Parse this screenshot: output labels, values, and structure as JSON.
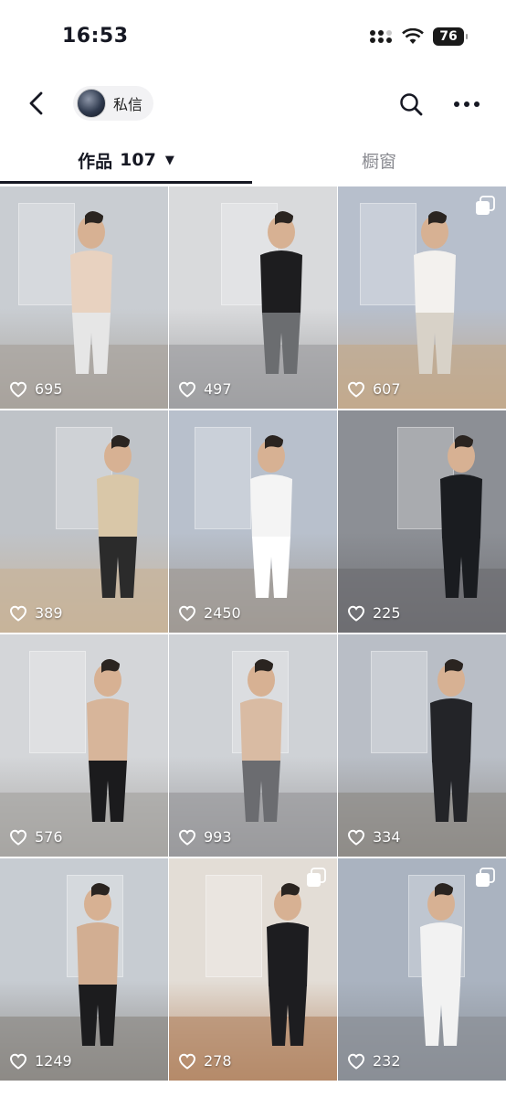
{
  "status_bar": {
    "time": "16:53",
    "battery": "76"
  },
  "nav": {
    "pill_label": "私信"
  },
  "tabs": {
    "works_label": "作品",
    "works_count": "107",
    "caret": "▼",
    "shop_label": "橱窗"
  },
  "posts": [
    {
      "likes": "695",
      "multi": false,
      "bg": "#c9cdd2",
      "floor": "#a8a39c",
      "shirt": "#e8d2c0",
      "pants": "#e6e6e6"
    },
    {
      "likes": "497",
      "multi": false,
      "bg": "#d9dadc",
      "floor": "#9fa0a2",
      "shirt": "#1d1d1f",
      "pants": "#6b6d70"
    },
    {
      "likes": "607",
      "multi": true,
      "bg": "#b7bfcc",
      "floor": "#c2a98d",
      "shirt": "#f3f1ee",
      "pants": "#d8d2c8"
    },
    {
      "likes": "389",
      "multi": false,
      "bg": "#bfc3c8",
      "floor": "#c7b39a",
      "shirt": "#d9c7a8",
      "pants": "#2b2b2b"
    },
    {
      "likes": "2450",
      "multi": false,
      "bg": "#b8c0cc",
      "floor": "#a09a94",
      "shirt": "#f4f4f4",
      "pants": "#ffffff"
    },
    {
      "likes": "225",
      "multi": false,
      "bg": "#8c8f95",
      "floor": "#6e6e72",
      "shirt": "#1a1c20",
      "pants": "#1a1c20"
    },
    {
      "likes": "576",
      "multi": false,
      "bg": "#d4d6d9",
      "floor": "#a7a5a2",
      "shirt": "#d7b59a",
      "pants": "#1b1b1d"
    },
    {
      "likes": "993",
      "multi": false,
      "bg": "#cfd2d6",
      "floor": "#9a9a9c",
      "shirt": "#d9bba3",
      "pants": "#6b6c70"
    },
    {
      "likes": "334",
      "multi": false,
      "bg": "#b9bec6",
      "floor": "#8f8c88",
      "shirt": "#232428",
      "pants": "#232428"
    },
    {
      "likes": "1249",
      "multi": false,
      "bg": "#c7ccd2",
      "floor": "#8d8a86",
      "shirt": "#d2ae92",
      "pants": "#1c1c1e"
    },
    {
      "likes": "278",
      "multi": true,
      "bg": "#e3ddd6",
      "floor": "#b58a6a",
      "shirt": "#1d1d20",
      "pants": "#1d1d20"
    },
    {
      "likes": "232",
      "multi": true,
      "bg": "#aab3c0",
      "floor": "#8a8f96",
      "shirt": "#f2f2f2",
      "pants": "#f2f2f2"
    }
  ]
}
